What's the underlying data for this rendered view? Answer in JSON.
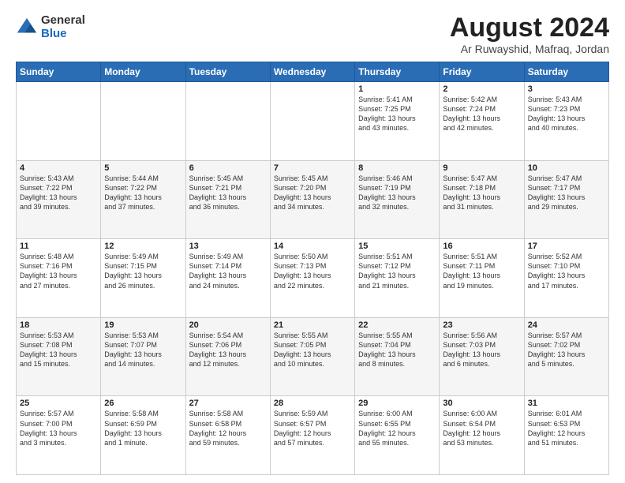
{
  "logo": {
    "general": "General",
    "blue": "Blue"
  },
  "title": "August 2024",
  "subtitle": "Ar Ruwayshid, Mafraq, Jordan",
  "days_of_week": [
    "Sunday",
    "Monday",
    "Tuesday",
    "Wednesday",
    "Thursday",
    "Friday",
    "Saturday"
  ],
  "weeks": [
    [
      {
        "day": "",
        "info": ""
      },
      {
        "day": "",
        "info": ""
      },
      {
        "day": "",
        "info": ""
      },
      {
        "day": "",
        "info": ""
      },
      {
        "day": "1",
        "info": "Sunrise: 5:41 AM\nSunset: 7:25 PM\nDaylight: 13 hours\nand 43 minutes."
      },
      {
        "day": "2",
        "info": "Sunrise: 5:42 AM\nSunset: 7:24 PM\nDaylight: 13 hours\nand 42 minutes."
      },
      {
        "day": "3",
        "info": "Sunrise: 5:43 AM\nSunset: 7:23 PM\nDaylight: 13 hours\nand 40 minutes."
      }
    ],
    [
      {
        "day": "4",
        "info": "Sunrise: 5:43 AM\nSunset: 7:22 PM\nDaylight: 13 hours\nand 39 minutes."
      },
      {
        "day": "5",
        "info": "Sunrise: 5:44 AM\nSunset: 7:22 PM\nDaylight: 13 hours\nand 37 minutes."
      },
      {
        "day": "6",
        "info": "Sunrise: 5:45 AM\nSunset: 7:21 PM\nDaylight: 13 hours\nand 36 minutes."
      },
      {
        "day": "7",
        "info": "Sunrise: 5:45 AM\nSunset: 7:20 PM\nDaylight: 13 hours\nand 34 minutes."
      },
      {
        "day": "8",
        "info": "Sunrise: 5:46 AM\nSunset: 7:19 PM\nDaylight: 13 hours\nand 32 minutes."
      },
      {
        "day": "9",
        "info": "Sunrise: 5:47 AM\nSunset: 7:18 PM\nDaylight: 13 hours\nand 31 minutes."
      },
      {
        "day": "10",
        "info": "Sunrise: 5:47 AM\nSunset: 7:17 PM\nDaylight: 13 hours\nand 29 minutes."
      }
    ],
    [
      {
        "day": "11",
        "info": "Sunrise: 5:48 AM\nSunset: 7:16 PM\nDaylight: 13 hours\nand 27 minutes."
      },
      {
        "day": "12",
        "info": "Sunrise: 5:49 AM\nSunset: 7:15 PM\nDaylight: 13 hours\nand 26 minutes."
      },
      {
        "day": "13",
        "info": "Sunrise: 5:49 AM\nSunset: 7:14 PM\nDaylight: 13 hours\nand 24 minutes."
      },
      {
        "day": "14",
        "info": "Sunrise: 5:50 AM\nSunset: 7:13 PM\nDaylight: 13 hours\nand 22 minutes."
      },
      {
        "day": "15",
        "info": "Sunrise: 5:51 AM\nSunset: 7:12 PM\nDaylight: 13 hours\nand 21 minutes."
      },
      {
        "day": "16",
        "info": "Sunrise: 5:51 AM\nSunset: 7:11 PM\nDaylight: 13 hours\nand 19 minutes."
      },
      {
        "day": "17",
        "info": "Sunrise: 5:52 AM\nSunset: 7:10 PM\nDaylight: 13 hours\nand 17 minutes."
      }
    ],
    [
      {
        "day": "18",
        "info": "Sunrise: 5:53 AM\nSunset: 7:08 PM\nDaylight: 13 hours\nand 15 minutes."
      },
      {
        "day": "19",
        "info": "Sunrise: 5:53 AM\nSunset: 7:07 PM\nDaylight: 13 hours\nand 14 minutes."
      },
      {
        "day": "20",
        "info": "Sunrise: 5:54 AM\nSunset: 7:06 PM\nDaylight: 13 hours\nand 12 minutes."
      },
      {
        "day": "21",
        "info": "Sunrise: 5:55 AM\nSunset: 7:05 PM\nDaylight: 13 hours\nand 10 minutes."
      },
      {
        "day": "22",
        "info": "Sunrise: 5:55 AM\nSunset: 7:04 PM\nDaylight: 13 hours\nand 8 minutes."
      },
      {
        "day": "23",
        "info": "Sunrise: 5:56 AM\nSunset: 7:03 PM\nDaylight: 13 hours\nand 6 minutes."
      },
      {
        "day": "24",
        "info": "Sunrise: 5:57 AM\nSunset: 7:02 PM\nDaylight: 13 hours\nand 5 minutes."
      }
    ],
    [
      {
        "day": "25",
        "info": "Sunrise: 5:57 AM\nSunset: 7:00 PM\nDaylight: 13 hours\nand 3 minutes."
      },
      {
        "day": "26",
        "info": "Sunrise: 5:58 AM\nSunset: 6:59 PM\nDaylight: 13 hours\nand 1 minute."
      },
      {
        "day": "27",
        "info": "Sunrise: 5:58 AM\nSunset: 6:58 PM\nDaylight: 12 hours\nand 59 minutes."
      },
      {
        "day": "28",
        "info": "Sunrise: 5:59 AM\nSunset: 6:57 PM\nDaylight: 12 hours\nand 57 minutes."
      },
      {
        "day": "29",
        "info": "Sunrise: 6:00 AM\nSunset: 6:55 PM\nDaylight: 12 hours\nand 55 minutes."
      },
      {
        "day": "30",
        "info": "Sunrise: 6:00 AM\nSunset: 6:54 PM\nDaylight: 12 hours\nand 53 minutes."
      },
      {
        "day": "31",
        "info": "Sunrise: 6:01 AM\nSunset: 6:53 PM\nDaylight: 12 hours\nand 51 minutes."
      }
    ]
  ]
}
